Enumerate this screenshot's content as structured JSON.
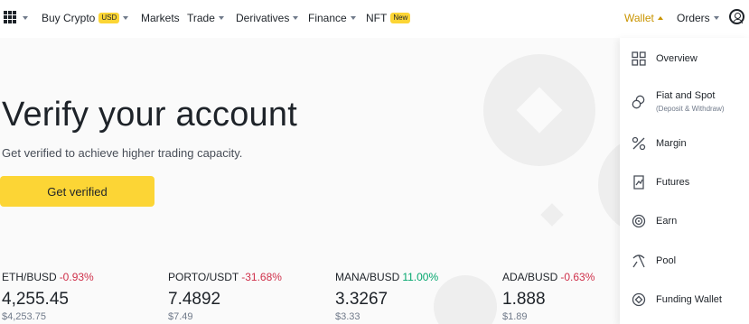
{
  "nav": {
    "items": [
      {
        "label": "Buy Crypto",
        "badge": "USD"
      },
      {
        "label": "Markets"
      },
      {
        "label": "Trade"
      },
      {
        "label": "Derivatives"
      },
      {
        "label": "Finance"
      },
      {
        "label": "NFT",
        "badge": "New"
      }
    ],
    "wallet": "Wallet",
    "orders": "Orders"
  },
  "hero": {
    "title": "Verify your account",
    "subtitle": "Get verified to achieve higher trading capacity.",
    "cta": "Get verified"
  },
  "tickers": [
    {
      "pair": "ETH/BUSD",
      "change": "-0.93%",
      "price": "4,255.45",
      "usd": "$4,253.75",
      "direction": "down"
    },
    {
      "pair": "PORTO/USDT",
      "change": "-31.68%",
      "price": "7.4892",
      "usd": "$7.49",
      "direction": "down"
    },
    {
      "pair": "MANA/BUSD",
      "change": "11.00%",
      "price": "3.3267",
      "usd": "$3.33",
      "direction": "up"
    },
    {
      "pair": "ADA/BUSD",
      "change": "-0.63%",
      "price": "1.888",
      "usd": "$1.89",
      "direction": "down"
    }
  ],
  "wallet_menu": {
    "items": [
      {
        "label": "Overview",
        "icon": "grid-icon"
      },
      {
        "label": "Fiat and Spot",
        "sub": "(Deposit & Withdraw)",
        "icon": "coins-icon"
      },
      {
        "label": "Margin",
        "icon": "percent-icon"
      },
      {
        "label": "Futures",
        "icon": "futures-chart-icon"
      },
      {
        "label": "Earn",
        "icon": "earn-target-icon"
      },
      {
        "label": "Pool",
        "icon": "pickaxe-icon"
      },
      {
        "label": "Funding Wallet",
        "icon": "funding-wallet-icon"
      }
    ]
  },
  "colors": {
    "accent": "#fcd535",
    "active_nav": "#c99400",
    "negative": "#cf304a",
    "positive": "#03a66d"
  }
}
